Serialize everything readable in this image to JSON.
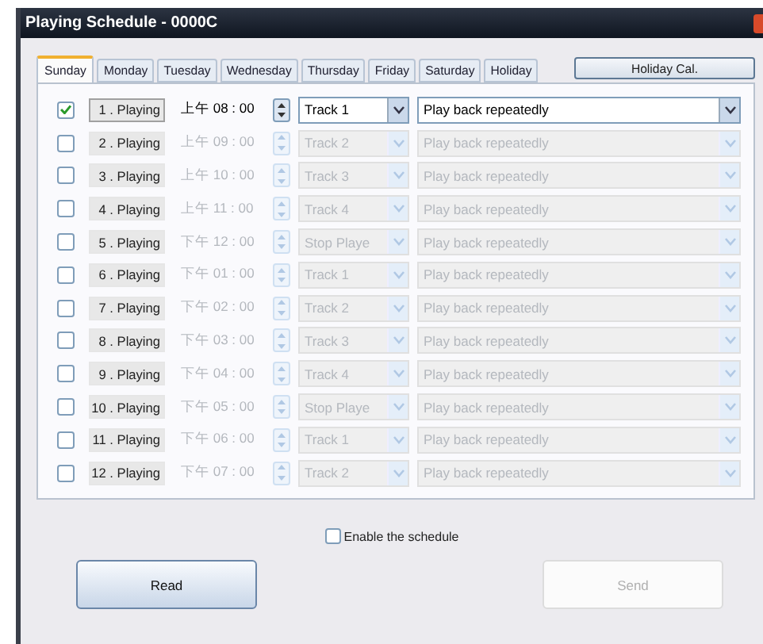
{
  "window": {
    "title": "Playing Schedule - 0000C"
  },
  "tabs": [
    {
      "label": "Sunday",
      "selected": true
    },
    {
      "label": "Monday",
      "selected": false
    },
    {
      "label": "Tuesday",
      "selected": false
    },
    {
      "label": "Wednesday",
      "selected": false
    },
    {
      "label": "Thursday",
      "selected": false
    },
    {
      "label": "Friday",
      "selected": false
    },
    {
      "label": "Saturday",
      "selected": false
    },
    {
      "label": "Holiday",
      "selected": false
    }
  ],
  "holiday_button": "Holiday Cal.",
  "rows": [
    {
      "checked": true,
      "label": "1 . Playing",
      "time": "上午 08 : 00",
      "track": "Track 1",
      "mode": "Play back repeatedly"
    },
    {
      "checked": false,
      "label": "2 . Playing",
      "time": "上午 09 : 00",
      "track": "Track 2",
      "mode": "Play back repeatedly"
    },
    {
      "checked": false,
      "label": "3 . Playing",
      "time": "上午 10 : 00",
      "track": "Track 3",
      "mode": "Play back repeatedly"
    },
    {
      "checked": false,
      "label": "4 . Playing",
      "time": "上午 11 : 00",
      "track": "Track 4",
      "mode": "Play back repeatedly"
    },
    {
      "checked": false,
      "label": "5 . Playing",
      "time": "下午 12 : 00",
      "track": "Stop Playe",
      "mode": "Play back repeatedly"
    },
    {
      "checked": false,
      "label": "6 . Playing",
      "time": "下午 01 : 00",
      "track": "Track 1",
      "mode": "Play back repeatedly"
    },
    {
      "checked": false,
      "label": "7 . Playing",
      "time": "下午 02 : 00",
      "track": "Track 2",
      "mode": "Play back repeatedly"
    },
    {
      "checked": false,
      "label": "8 . Playing",
      "time": "下午 03 : 00",
      "track": "Track 3",
      "mode": "Play back repeatedly"
    },
    {
      "checked": false,
      "label": "9 . Playing",
      "time": "下午 04 : 00",
      "track": "Track 4",
      "mode": "Play back repeatedly"
    },
    {
      "checked": false,
      "label": "10 . Playing",
      "time": "下午 05 : 00",
      "track": "Stop Playe",
      "mode": "Play back repeatedly"
    },
    {
      "checked": false,
      "label": "11 . Playing",
      "time": "下午 06 : 00",
      "track": "Track 1",
      "mode": "Play back repeatedly"
    },
    {
      "checked": false,
      "label": "12 . Playing",
      "time": "下午 07 : 00",
      "track": "Track 2",
      "mode": "Play back repeatedly"
    }
  ],
  "enable": {
    "label": "Enable the schedule",
    "checked": false
  },
  "buttons": [
    {
      "label": "Read",
      "disabled": false
    },
    {
      "label": "Send",
      "disabled": true
    }
  ]
}
